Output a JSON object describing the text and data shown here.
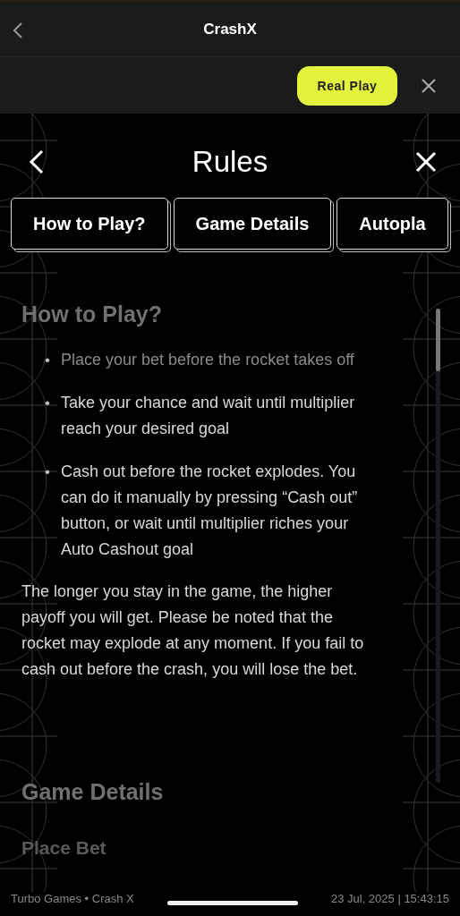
{
  "app_bar": {
    "title": "CrashX"
  },
  "mode_bar": {
    "button": "Real Play"
  },
  "rules": {
    "title": "Rules",
    "tabs": [
      {
        "label": "How to Play?"
      },
      {
        "label": "Game Details"
      },
      {
        "label": "Autopla"
      }
    ],
    "sections": [
      {
        "heading": "How to Play?",
        "bullets": [
          {
            "marker": "•",
            "text": "Place your bet before the rocket takes off"
          },
          {
            "marker": "•",
            "text": "Take your chance and wait until multiplier reach your desired goal"
          },
          {
            "marker": "•",
            "text": "Cash out before the rocket explodes. You can do it manually by pressing “Cash out” button, or wait until multiplier riches your Auto Cashout goal"
          }
        ],
        "paragraph": "The longer you stay in the game, the higher payoff you will get. Please be noted that the rocket may explode at any moment. If you fail to cash out before the crash, you will lose the bet."
      },
      {
        "heading": "Game Details",
        "subheading": "Place Bet"
      }
    ]
  },
  "footer": {
    "left": "Turbo Games • Crash X",
    "right": "23 Jul, 2025 | 15:43:15"
  }
}
